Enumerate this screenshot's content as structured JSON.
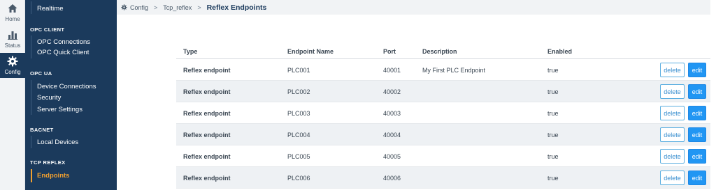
{
  "rail": [
    {
      "label": "Home",
      "icon": "home-icon"
    },
    {
      "label": "Status",
      "icon": "bar-chart-icon"
    },
    {
      "label": "Config",
      "icon": "gear-icon",
      "active": true
    }
  ],
  "sidebar": {
    "top_item": "Realtime",
    "sections": [
      {
        "heading": "OPC CLIENT",
        "items": [
          "OPC Connections",
          "OPC Quick Client"
        ]
      },
      {
        "heading": "OPC UA",
        "items": [
          "Device Connections",
          "Security",
          "Server Settings"
        ]
      },
      {
        "heading": "BACNET",
        "items": [
          "Local Devices"
        ]
      },
      {
        "heading": "TCP REFLEX",
        "items": [
          "Endpoints"
        ]
      }
    ],
    "active_item": "Endpoints"
  },
  "breadcrumb": {
    "items": [
      "Config",
      "Tcp_reflex"
    ],
    "current": "Reflex Endpoints",
    "separator": ">"
  },
  "table": {
    "columns": [
      "Type",
      "Endpoint Name",
      "Port",
      "Description",
      "Enabled"
    ],
    "rows": [
      {
        "type": "Reflex endpoint",
        "name": "PLC001",
        "port": "40001",
        "description": "My First PLC Endpoint",
        "enabled": "true"
      },
      {
        "type": "Reflex endpoint",
        "name": "PLC002",
        "port": "40002",
        "description": "",
        "enabled": "true"
      },
      {
        "type": "Reflex endpoint",
        "name": "PLC003",
        "port": "40003",
        "description": "",
        "enabled": "true"
      },
      {
        "type": "Reflex endpoint",
        "name": "PLC004",
        "port": "40004",
        "description": "",
        "enabled": "true"
      },
      {
        "type": "Reflex endpoint",
        "name": "PLC005",
        "port": "40005",
        "description": "",
        "enabled": "true"
      },
      {
        "type": "Reflex endpoint",
        "name": "PLC006",
        "port": "40006",
        "description": "",
        "enabled": "true"
      }
    ],
    "delete_label": "delete",
    "edit_label": "edit"
  },
  "colors": {
    "sidebar_bg": "#1b3a5c",
    "active_accent": "#f0a030",
    "edit_button": "#2196f3",
    "delete_border": "#5aaee0",
    "row_alt": "#eef1f4"
  }
}
